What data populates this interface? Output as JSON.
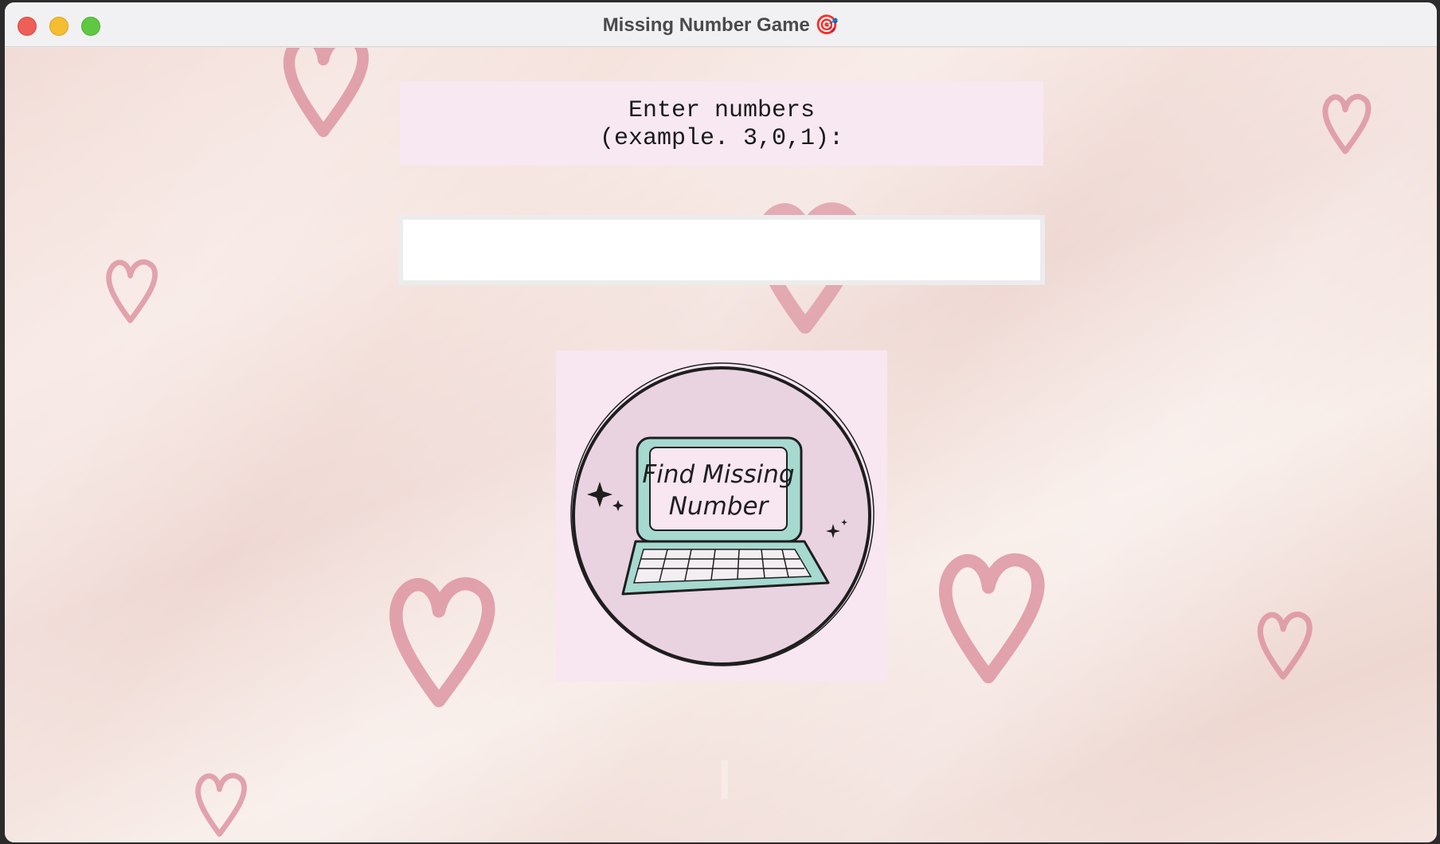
{
  "window": {
    "title": "Missing Number Game 🎯"
  },
  "prompt": {
    "line1": "Enter numbers",
    "line2": "(example. 3,0,1):"
  },
  "input": {
    "value": "",
    "placeholder": ""
  },
  "logo": {
    "line1": "Find Missing",
    "line2": "Number"
  },
  "colors": {
    "heart": "#d98a98",
    "prompt_bg": "#f8e8f1",
    "logo_bg": "#f8e6f1",
    "laptop": "#a6d9cf"
  }
}
